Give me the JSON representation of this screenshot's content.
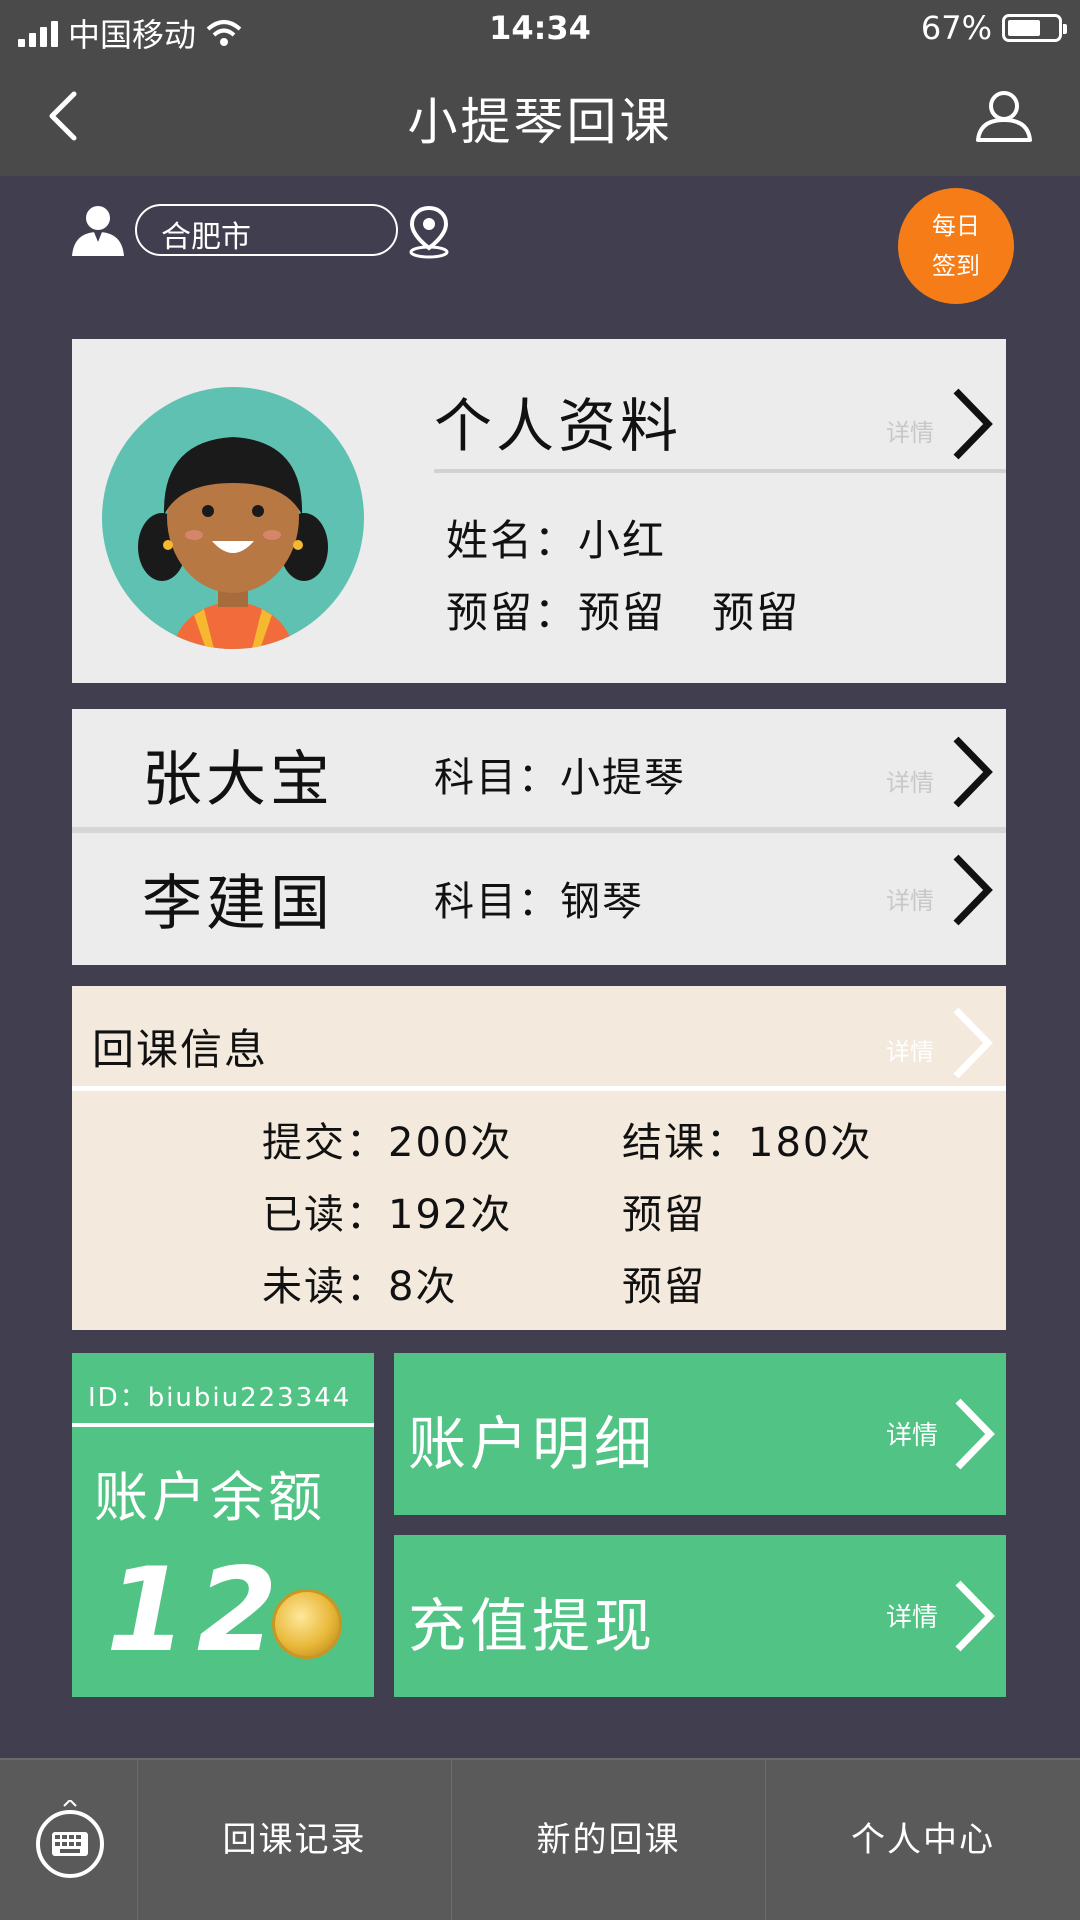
{
  "statusbar": {
    "carrier": "中国移动",
    "time": "14:34",
    "battery": "67%"
  },
  "navbar": {
    "title": "小提琴回课"
  },
  "location": {
    "city": "合肥市",
    "checkin_line1": "每日",
    "checkin_line2": "签到"
  },
  "profile": {
    "title": "个人资料",
    "detail": "详情",
    "name_label": "姓名：",
    "name_value": "小红",
    "reserve_label": "预留：",
    "reserve_value1": "预留",
    "reserve_value2": "预留"
  },
  "students": [
    {
      "name": "张大宝",
      "subject_label": "科目：",
      "subject": "小提琴",
      "detail": "详情"
    },
    {
      "name": "李建国",
      "subject_label": "科目：",
      "subject": "钢琴",
      "detail": "详情"
    }
  ],
  "lesson_info": {
    "title": "回课信息",
    "detail": "详情",
    "submit": "提交：200次",
    "finish": "结课：180次",
    "read": "已读：192次",
    "reserve1": "预留",
    "unread": "未读：8次",
    "reserve2": "预留"
  },
  "account": {
    "id": "ID：biubiu223344",
    "balance_label": "账户余额",
    "balance": "12",
    "detail_label": "账户明细",
    "detail_link": "详情",
    "recharge_label": "充值提现",
    "recharge_link": "详情"
  },
  "tabbar": {
    "tab1": "回课记录",
    "tab2": "新的回课",
    "tab3": "个人中心"
  },
  "colors": {
    "background": "#403e4f",
    "bar": "#4a4a4a",
    "accent_orange": "#f57c17",
    "green": "#51c485",
    "card": "#ececec",
    "info_bg": "#f3e9dc"
  },
  "icons": [
    "back-icon",
    "user-icon",
    "person-icon",
    "location-pin-icon",
    "chevron-right-icon",
    "coin-icon",
    "keyboard-icon",
    "wifi-icon",
    "signal-icon",
    "battery-icon"
  ]
}
